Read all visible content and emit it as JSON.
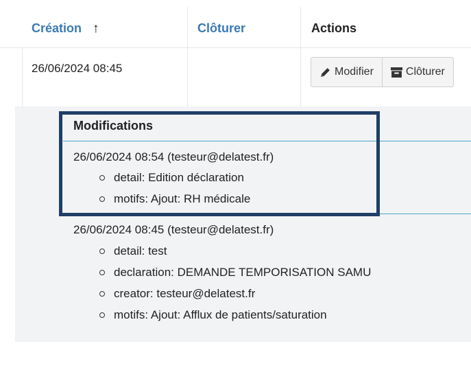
{
  "table": {
    "headers": {
      "creation": "Création",
      "sort_arrow": "↑",
      "cloturer": "Clôturer",
      "actions": "Actions"
    },
    "row": {
      "creation": "26/06/2024 08:45",
      "cloturer": "",
      "buttons": {
        "modifier": "Modifier",
        "cloturer": "Clôturer"
      }
    }
  },
  "modifications": {
    "title": "Modifications",
    "entries": [
      {
        "head": "26/06/2024 08:54 (testeur@delatest.fr)",
        "items": [
          "detail: Edition déclaration",
          "motifs: Ajout: RH médicale"
        ]
      },
      {
        "head": "26/06/2024 08:45 (testeur@delatest.fr)",
        "items": [
          "detail: test",
          "declaration: DEMANDE TEMPORISATION SAMU",
          "creator: testeur@delatest.fr",
          "motifs: Ajout: Afflux de patients/saturation"
        ]
      }
    ]
  },
  "colors": {
    "link": "#3a7ab3",
    "panel_bg": "#f2f3f5",
    "divider": "#4aa3c9",
    "focus_border": "#1f3f66"
  },
  "icons": {
    "modifier": "pencil-icon",
    "cloturer": "archive-icon"
  }
}
